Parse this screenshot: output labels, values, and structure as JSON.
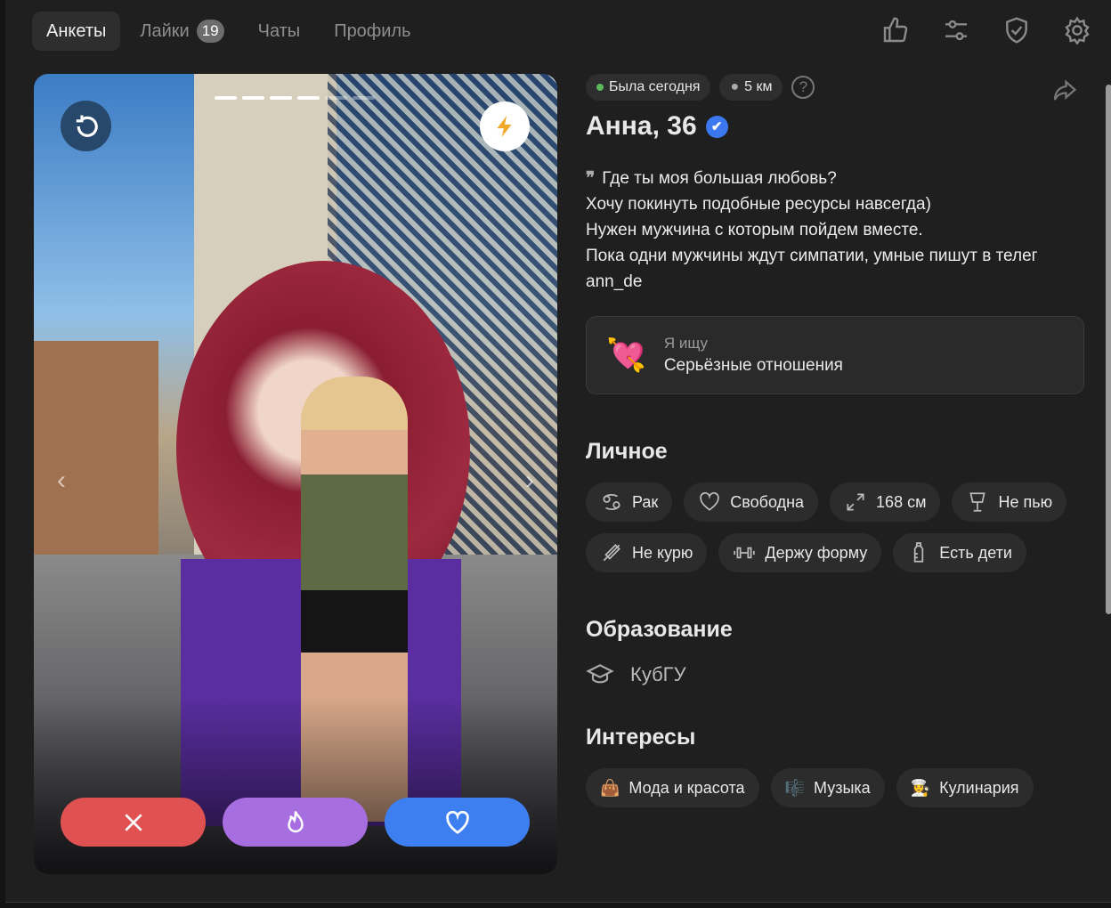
{
  "nav": {
    "tabs": [
      {
        "label": "Анкеты",
        "active": true
      },
      {
        "label": "Лайки",
        "badge": "19"
      },
      {
        "label": "Чаты"
      },
      {
        "label": "Профиль"
      }
    ],
    "icons": [
      "thumbs-up-icon",
      "filter-sliders-icon",
      "shield-check-icon",
      "gear-icon"
    ]
  },
  "photo": {
    "total": 6,
    "current": 4,
    "undo_icon": "undo-icon",
    "boost_icon": "lightning-icon",
    "actions": [
      {
        "name": "dislike",
        "color": "#e05252",
        "icon": "close-icon"
      },
      {
        "name": "superlike",
        "color": "#a76ee0",
        "icon": "flame-icon"
      },
      {
        "name": "like",
        "color": "#3d7ef0",
        "icon": "heart-icon"
      }
    ]
  },
  "profile": {
    "status": "Была сегодня",
    "distance": "5 км",
    "help": "?",
    "name": "Анна, 36",
    "verified": true,
    "bio": [
      "Где ты моя большая любовь?",
      "Хочу покинуть подобные ресурсы навсегда)",
      "Нужен мужчина с которым пойдем вместе.",
      "Пока одни мужчины ждут симпатии, умные пишут в телег",
      "ann_de"
    ],
    "looking": {
      "label": "Я ищу",
      "value": "Серьёзные отношения",
      "emoji": "💘"
    },
    "personal_title": "Личное",
    "personal": [
      "Рак",
      "Свободна",
      "168 см",
      "Не пью",
      "Не курю",
      "Держу форму",
      "Есть дети"
    ],
    "education_title": "Образование",
    "education": "КубГУ",
    "interests_title": "Интересы",
    "interests": [
      {
        "emoji": "👜",
        "label": "Мода и красота"
      },
      {
        "emoji": "🎼",
        "label": "Музыка"
      },
      {
        "emoji": "👩‍🍳",
        "label": "Кулинария"
      }
    ]
  }
}
